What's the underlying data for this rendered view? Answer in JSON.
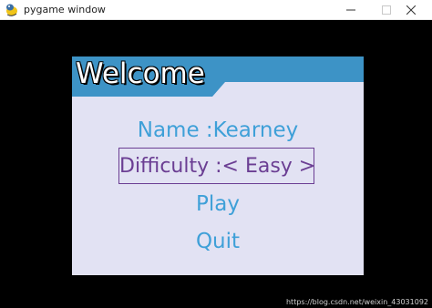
{
  "window": {
    "title": "pygame window",
    "icon": "python-snake-icon",
    "controls": [
      "minimize-icon",
      "maximize-icon",
      "close-icon"
    ]
  },
  "menu": {
    "title": "Welcome",
    "items": {
      "name": "Name :Kearney",
      "difficulty": "Difficulty :< Easy >",
      "play": "Play",
      "quit": "Quit"
    },
    "selected_item": "difficulty"
  },
  "colors": {
    "window_background": "#000000",
    "menu_background": "#e2e2f3",
    "header": "#3d93c6",
    "item_text": "#3fa0d8",
    "selected_text": "#6b3e93"
  },
  "watermark": "https://blog.csdn.net/weixin_43031092"
}
